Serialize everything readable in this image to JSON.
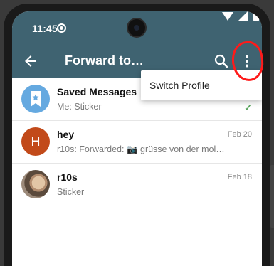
{
  "status_bar": {
    "time": "11:45",
    "icons": [
      "sync-icon",
      "wifi-icon",
      "signal-icon",
      "battery-icon"
    ]
  },
  "toolbar": {
    "title": "Forward to…",
    "back_icon": "arrow-back-icon",
    "search_icon": "search-icon",
    "more_icon": "more-vert-icon",
    "color": "#3f6371"
  },
  "menu": {
    "items": [
      {
        "label": "Switch Profile"
      }
    ]
  },
  "chats": [
    {
      "name": "Saved Messages",
      "message": "Me: Sticker",
      "date": "",
      "avatar": "bookmark-icon",
      "status": "check-icon"
    },
    {
      "name": "hey",
      "message": "r10s: Forwarded: 📷 grüsse von der mol…",
      "date": "Feb 20",
      "avatar_letter": "H"
    },
    {
      "name": "r10s",
      "message": "Sticker",
      "date": "Feb 18",
      "avatar": "photo"
    }
  ],
  "annotation": {
    "color": "#ff1a1a",
    "note": "red hand-drawn circle around the more-vert menu button"
  }
}
